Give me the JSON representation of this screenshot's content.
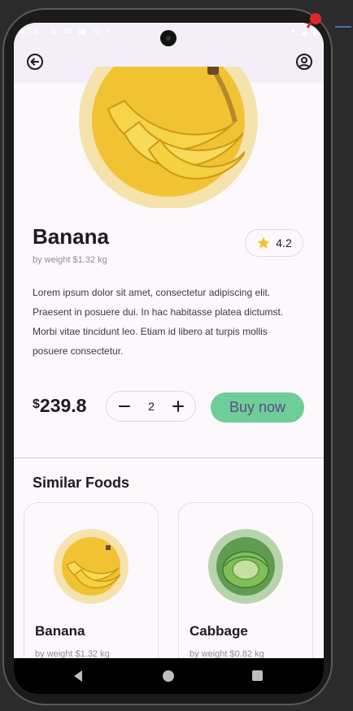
{
  "status_bar": {
    "time": "4:56",
    "left_icons": [
      "gear-icon",
      "mail-icon",
      "sim-icon",
      "google-icon",
      "dot-icon"
    ],
    "right_icons": [
      "wifi-icon",
      "signal-icon",
      "battery-icon"
    ]
  },
  "app_bar": {
    "back_icon": "back-arrow-icon",
    "profile_icon": "account-circle-icon"
  },
  "product": {
    "name": "Banana",
    "weight": "by weight $1.32 kg",
    "rating": "4.2",
    "description": "Lorem ipsum dolor sit amet, consectetur adipiscing elit. Praesent in posuere dui. In hac habitasse platea dictumst. Morbi vitae tincidunt leo. Etiam id libero at turpis mollis posuere consectetur.",
    "price_currency": "$",
    "price_amount": "239.8",
    "quantity": "2",
    "buy_label": "Buy now"
  },
  "similar": {
    "title": "Similar Foods",
    "items": [
      {
        "name": "Banana",
        "weight": "by weight $1.32 kg",
        "ring_color": "#f6e2ad",
        "circle_color": "#f1c232"
      },
      {
        "name": "Cabbage",
        "weight": "by weight $0.82 kg",
        "ring_color": "#b8d4ad",
        "circle_color": "#5f9b50"
      }
    ]
  },
  "colors": {
    "accent_green": "#6fce98",
    "buy_text": "#5b4b8a",
    "banana_yellow": "#f1c232",
    "app_bar_bg": "#f3eef7"
  }
}
